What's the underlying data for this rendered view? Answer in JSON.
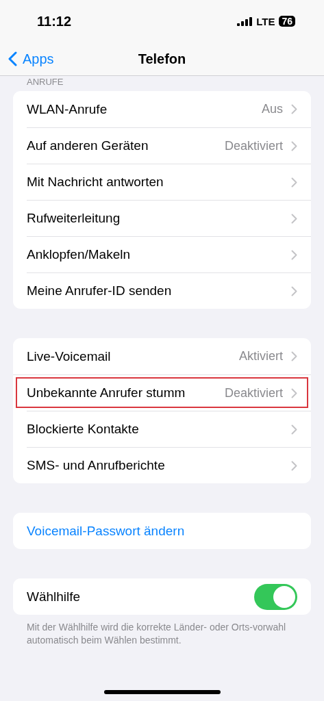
{
  "status_bar": {
    "time": "11:12",
    "network": "LTE",
    "battery": "76"
  },
  "nav": {
    "back": "Apps",
    "title": "Telefon"
  },
  "sections": [
    {
      "header": "ANRUFE",
      "rows": [
        {
          "kind": "value",
          "label": "WLAN-Anrufe",
          "value": "Aus",
          "highlighted": false
        },
        {
          "kind": "value",
          "label": "Auf anderen Geräten",
          "value": "Deaktiviert",
          "highlighted": false
        },
        {
          "kind": "value",
          "label": "Mit Nachricht antworten",
          "highlighted": false
        },
        {
          "kind": "value",
          "label": "Rufweiterleitung",
          "highlighted": false
        },
        {
          "kind": "value",
          "label": "Anklopfen/Makeln",
          "highlighted": false
        },
        {
          "kind": "value",
          "label": "Meine Anrufer-ID senden",
          "highlighted": false
        }
      ]
    },
    {
      "rows": [
        {
          "kind": "value",
          "label": "Live-Voicemail",
          "value": "Aktiviert",
          "highlighted": false
        },
        {
          "kind": "value",
          "label": "Unbekannte Anrufer stumm",
          "value": "Deaktiviert",
          "highlighted": true
        },
        {
          "kind": "value",
          "label": "Blockierte Kontakte",
          "highlighted": false
        },
        {
          "kind": "value",
          "label": "SMS- und Anrufberichte",
          "highlighted": false
        }
      ]
    },
    {
      "rows": [
        {
          "kind": "link",
          "label": "Voicemail-Passwort ändern",
          "highlighted": false
        }
      ]
    },
    {
      "rows": [
        {
          "kind": "toggle",
          "label": "Wählhilfe",
          "on": true,
          "highlighted": false
        }
      ],
      "footer": "Mit der Wählhilfe wird die korrekte Länder- oder Orts-vorwahl automatisch beim Wählen bestimmt."
    }
  ]
}
